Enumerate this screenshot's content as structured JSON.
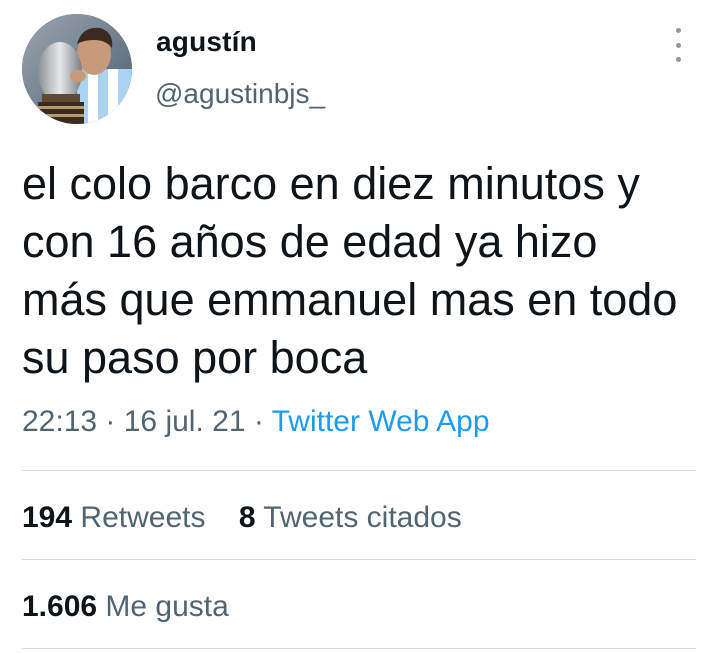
{
  "user": {
    "display_name": "agustín",
    "handle": "@agustinbjs_",
    "avatar_icon": "profile-photo-trophy"
  },
  "tweet": {
    "text": "el colo barco en diez minutos y con 16 años de edad ya hizo más que emmanuel mas en todo su paso por boca"
  },
  "meta": {
    "time": "22:13",
    "separator": " · ",
    "date": "16 jul. 21",
    "source": "Twitter Web App"
  },
  "stats": {
    "retweets_count": "194",
    "retweets_label": "Retweets",
    "quotes_count": "8",
    "quotes_label": "Tweets citados",
    "likes_count": "1.606",
    "likes_label": "Me gusta"
  },
  "colors": {
    "primary_text": "#0f1419",
    "secondary_text": "#536471",
    "link": "#1d9bf0",
    "divider": "#d8dde1"
  }
}
